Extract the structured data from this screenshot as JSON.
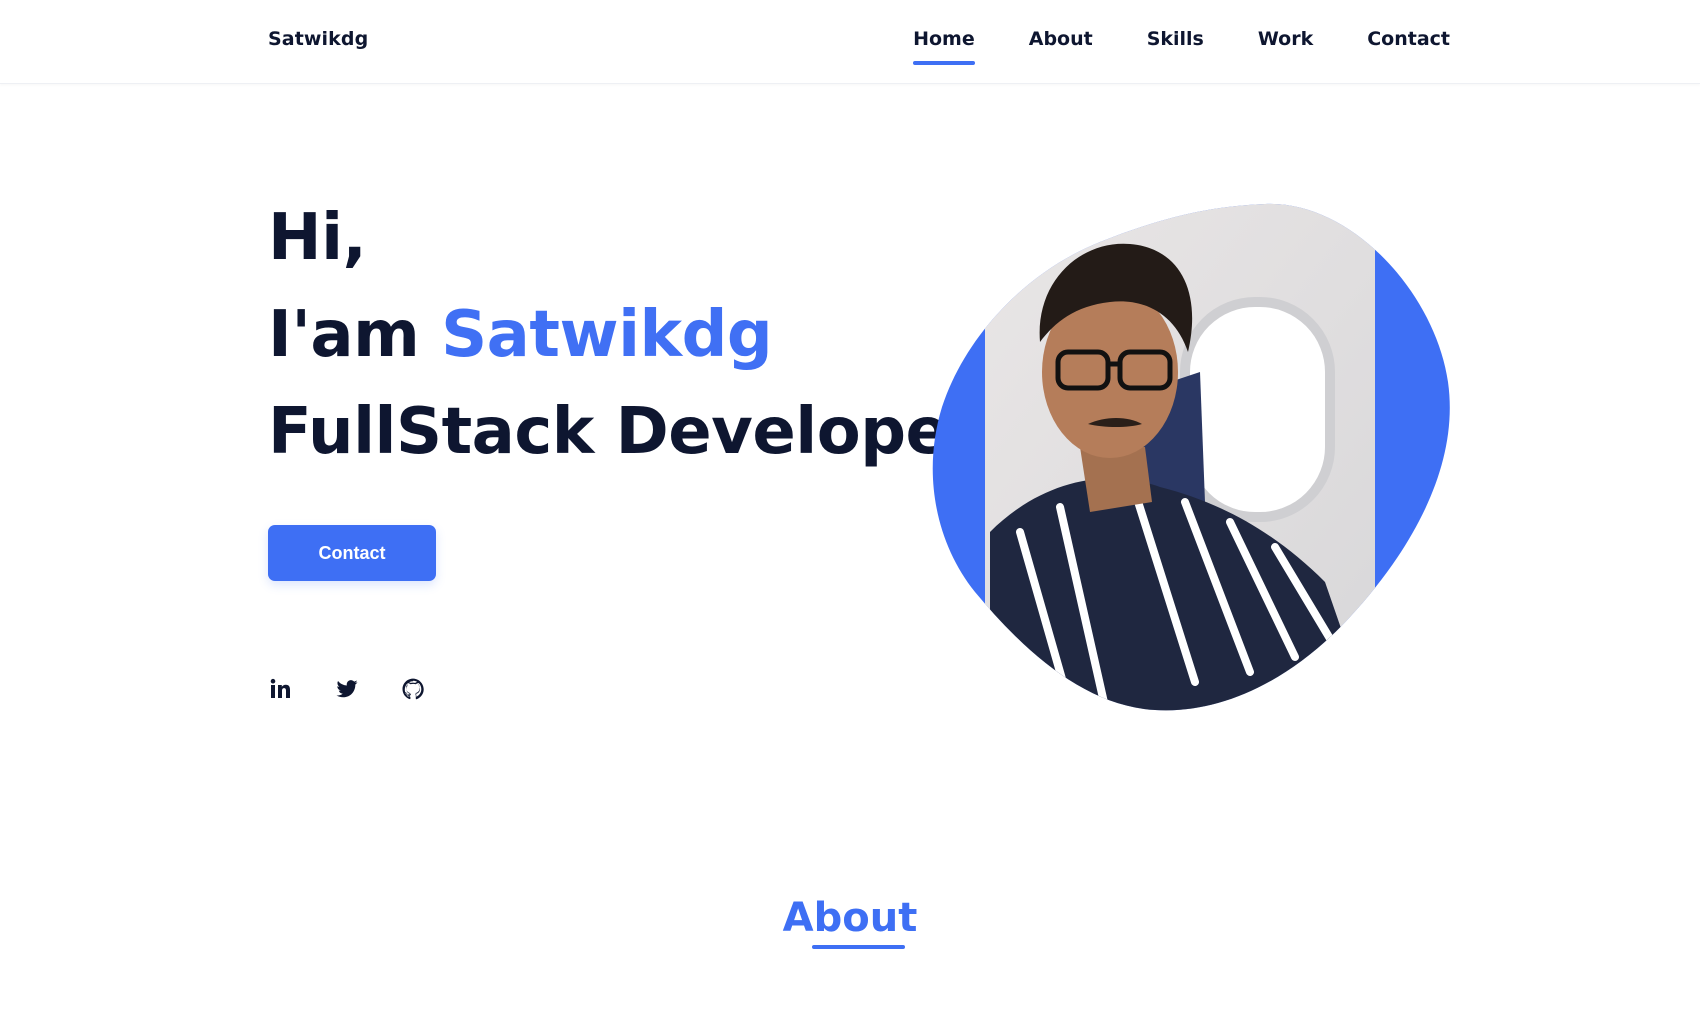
{
  "header": {
    "logo": "Satwikdg",
    "nav": [
      {
        "label": "Home",
        "active": true
      },
      {
        "label": "About",
        "active": false
      },
      {
        "label": "Skills",
        "active": false
      },
      {
        "label": "Work",
        "active": false
      },
      {
        "label": "Contact",
        "active": false
      }
    ]
  },
  "hero": {
    "line1": "Hi,",
    "line2_prefix": "I'am ",
    "line2_name": "Satwikdg",
    "line3": "FullStack Developer",
    "button_label": "Contact",
    "socials": [
      {
        "icon": "linkedin-icon"
      },
      {
        "icon": "twitter-icon"
      },
      {
        "icon": "github-icon"
      }
    ],
    "image": "profile-photo"
  },
  "about": {
    "title": "About"
  },
  "colors": {
    "accent": "#3e6ff4",
    "text": "#0e1630"
  }
}
